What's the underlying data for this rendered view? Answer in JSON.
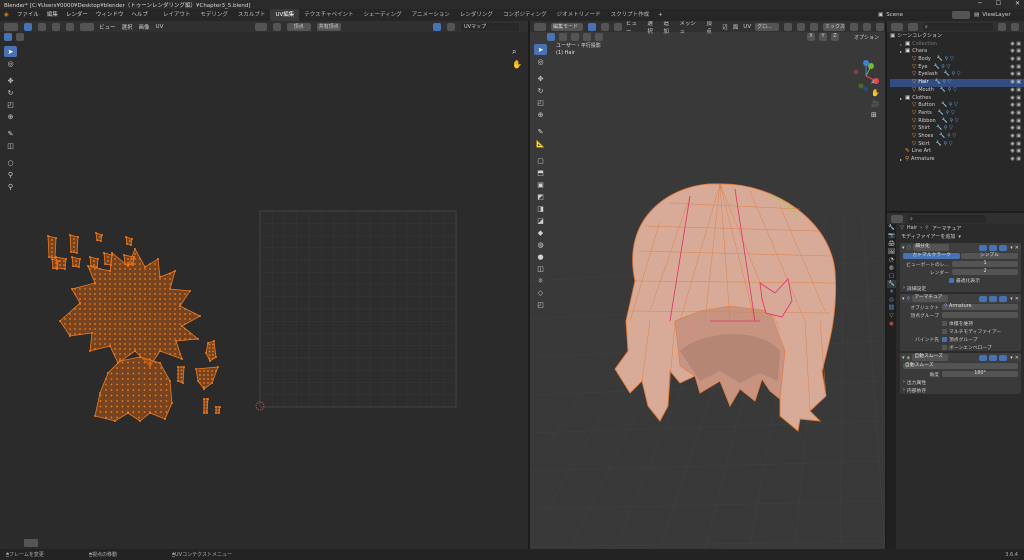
{
  "title": "Blender* [C:¥Users¥0000¥Desktop¥blender（トゥーンレンダリング編）¥Chapter3_5.blend]",
  "menus": [
    "ファイル",
    "編集",
    "レンダー",
    "ウィンドウ",
    "ヘルプ"
  ],
  "workspaces": [
    "レイアウト",
    "モデリング",
    "スカルプト",
    "UV編集",
    "テクスチャペイント",
    "シェーディング",
    "アニメーション",
    "レンダリング",
    "コンポジティング",
    "ジオメトリノード",
    "スクリプト作成"
  ],
  "active_workspace": "UV編集",
  "scene": "Scene",
  "view_layer": "ViewLayer",
  "uv_editor": {
    "header_items": [
      "ビュー",
      "選択",
      "画像",
      "UV"
    ],
    "image_name": "UVマップ",
    "sync_label": "頂点",
    "sticky_label": "共有頂点",
    "colors": {
      "bg": "#2b2b2b",
      "uv": "#f27b1c",
      "grid": "#3a3a3a"
    }
  },
  "viewport": {
    "mode": "編集モード",
    "header_items": [
      "ビュー",
      "選択",
      "追加",
      "メッシュ",
      "頂点",
      "辺",
      "面",
      "UV"
    ],
    "transform_orientation": "グロ...",
    "shading_label": "ミックス",
    "options_label": "オプション",
    "axis_labels": [
      "X",
      "Y",
      "Z"
    ],
    "overlay_text_1": "ユーザー・平行投影",
    "overlay_text_2": "(1) Hair"
  },
  "outliner": {
    "root": "シーンコレクション",
    "rows": [
      {
        "name": "Collection",
        "indent": 1,
        "icon": "collection-icon",
        "dim": true
      },
      {
        "name": "Chara",
        "indent": 1,
        "icon": "collection-icon"
      },
      {
        "name": "Body",
        "indent": 2,
        "icon": "mesh-icon"
      },
      {
        "name": "Eye",
        "indent": 2,
        "icon": "mesh-icon"
      },
      {
        "name": "Eyelash",
        "indent": 2,
        "icon": "mesh-icon"
      },
      {
        "name": "Hair",
        "indent": 2,
        "icon": "mesh-icon",
        "selected": true
      },
      {
        "name": "Mouth",
        "indent": 2,
        "icon": "mesh-icon"
      },
      {
        "name": "Clothes",
        "indent": 1,
        "icon": "collection-icon"
      },
      {
        "name": "Button",
        "indent": 2,
        "icon": "mesh-icon"
      },
      {
        "name": "Pants",
        "indent": 2,
        "icon": "mesh-icon"
      },
      {
        "name": "Ribbon",
        "indent": 2,
        "icon": "mesh-icon"
      },
      {
        "name": "Shirt",
        "indent": 2,
        "icon": "mesh-icon"
      },
      {
        "name": "Shoes",
        "indent": 2,
        "icon": "mesh-icon"
      },
      {
        "name": "Skirt",
        "indent": 2,
        "icon": "mesh-icon"
      },
      {
        "name": "Line Art",
        "indent": 1,
        "icon": "lineart-icon"
      },
      {
        "name": "Armature",
        "indent": 1,
        "icon": "armature-icon"
      }
    ]
  },
  "properties": {
    "breadcrumb_object": "Hair",
    "breadcrumb_mod": "アーマチュア",
    "add_modifier": "モディファイアーを追加",
    "subsurf": {
      "name": "細分化",
      "tabs": [
        "カトマルクラーク",
        "シンプル"
      ],
      "viewport_label": "ビューポートのレ...",
      "viewport_value": "1",
      "render_label": "レンダー",
      "render_value": "2",
      "optimal_label": "最適化表示",
      "advanced": "詳細設定"
    },
    "armature": {
      "name": "アーマチュア",
      "object_label": "オブジェクト",
      "object_value": "Armature",
      "vgroup_label": "頂点グループ",
      "preserve_volume": "体積を維持",
      "multi_modifier": "マルチモディファイアー",
      "bind_label": "バインド先",
      "bind_vgroups": "頂点グループ",
      "bind_envelope": "ボーンエンベロープ"
    },
    "autosmooth": {
      "name": "自動スムーズ",
      "field_value": "自動スムーズ",
      "angle_label": "角度",
      "angle_value": "180°",
      "output": "出力属性",
      "internal": "内部依存"
    }
  },
  "statusbar": {
    "left": "フレームを変更",
    "middle": "視点の移動",
    "right": "UVコンテクストメニュー",
    "version": "3.6.4"
  }
}
